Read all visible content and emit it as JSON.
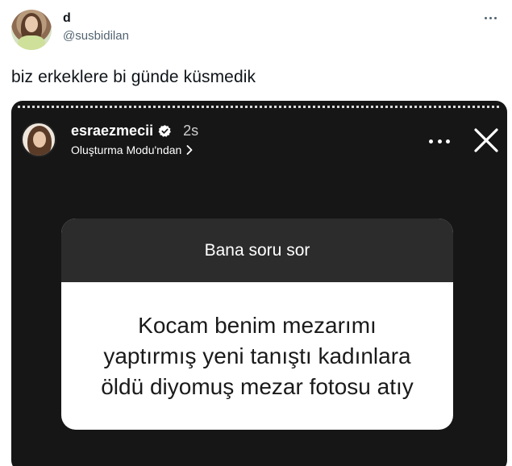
{
  "tweet": {
    "display_name": "d",
    "handle": "@susbidilan",
    "text": "biz erkeklere bi günde küsmedik",
    "more_icon": "more-horizontal-icon"
  },
  "story": {
    "username": "esraezmecii",
    "verified": true,
    "time": "2s",
    "subtitle": "Oluşturma Modu'ndan",
    "question_header": "Bana soru sor",
    "question_lines": [
      "Kocam benim mezarımı",
      "yaptırmış yeni tanıştı kadınlara",
      "öldü diyomuş mezar fotosu atıy"
    ],
    "icons": {
      "more": "more-horizontal-icon",
      "close": "close-icon",
      "verified": "verified-badge-icon",
      "chevron": "chevron-right-icon"
    }
  },
  "colors": {
    "handle": "#536471",
    "story_bg": "#161616",
    "question_header_bg": "#2c2c2c",
    "verified_badge": "#ffffff"
  }
}
